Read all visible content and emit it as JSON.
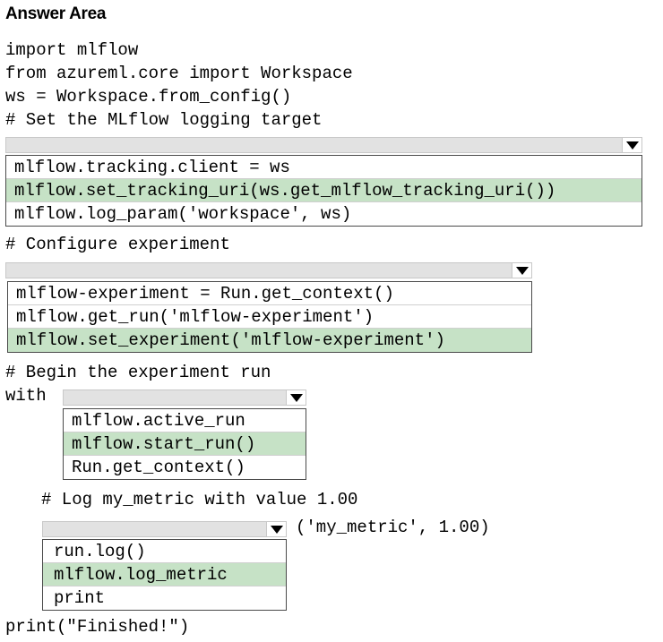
{
  "header": {
    "title": "Answer Area"
  },
  "code": {
    "line1": "import mlflow",
    "line2": "from azureml.core import Workspace",
    "line3": "ws = Workspace.from_config()",
    "line4": "# Set the MLflow logging target",
    "line5": "# Configure experiment",
    "line6": "# Begin the experiment run",
    "with_kw": "with",
    "line7": "# Log my_metric with value 1.00",
    "log_args": "('my_metric', 1.00)",
    "final": "print(\"Finished!\")"
  },
  "dropdowns": [
    {
      "options": [
        "mlflow.tracking.client = ws",
        "mlflow.set_tracking_uri(ws.get_mlflow_tracking_uri())",
        "mlflow.log_param('workspace', ws)"
      ],
      "selected_index": 1
    },
    {
      "options": [
        "mlflow-experiment = Run.get_context()",
        "mlflow.get_run('mlflow-experiment')",
        "mlflow.set_experiment('mlflow-experiment')"
      ],
      "selected_index": 2
    },
    {
      "options": [
        "mlflow.active_run",
        "mlflow.start_run()",
        "Run.get_context()"
      ],
      "selected_index": 1
    },
    {
      "options": [
        "run.log()",
        "mlflow.log_metric",
        "print"
      ],
      "selected_index": 1
    }
  ],
  "colors": {
    "selected_highlight": "#c6e2c6",
    "dropdown_bar": "#e2e2e2"
  },
  "icons": {
    "dropdown_arrow": "chevron-down-icon"
  }
}
